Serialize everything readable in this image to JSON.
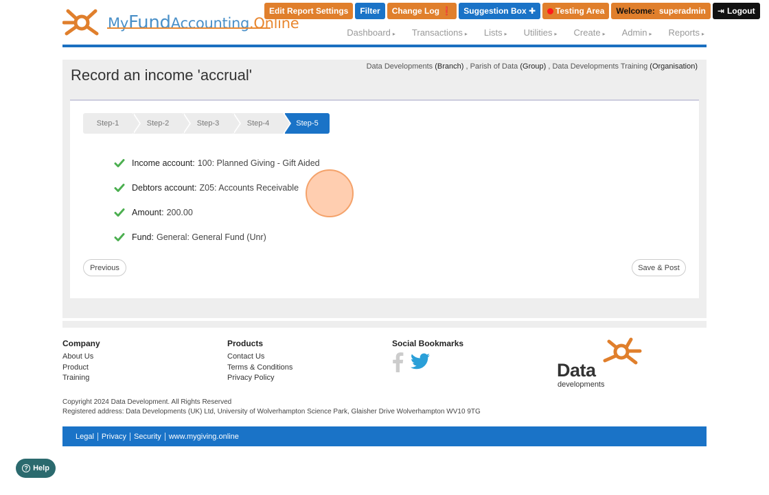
{
  "logo": {
    "part1": "My",
    "part2": "Fund",
    "part3": "Accounting",
    "part4": ".Online"
  },
  "top_buttons": {
    "edit_report_settings": "Edit Report Settings",
    "filter": "Filter",
    "change_log": "Change Log ❗",
    "suggestion_box": "Suggestion Box ✚",
    "testing_area": "Testing Area",
    "welcome_label": "Welcome:",
    "welcome_user": "superadmin",
    "logout": "Logout"
  },
  "nav": [
    "Dashboard",
    "Transactions",
    "Lists",
    "Utilities",
    "Create",
    "Admin",
    "Reports"
  ],
  "entity": {
    "branch_name": "Data Developments",
    "branch_tag": "(Branch)",
    "group_name": "Parish of Data",
    "group_tag": "(Group)",
    "org_name": "Data Developments Training",
    "org_tag": "(Organisation)"
  },
  "page_title": "Record an income 'accrual'",
  "steps": [
    "Step-1",
    "Step-2",
    "Step-3",
    "Step-4",
    "Step-5"
  ],
  "active_step": 5,
  "summary": [
    {
      "label": "Income account:",
      "value": "100: Planned Giving - Gift Aided"
    },
    {
      "label": "Debtors account:",
      "value": "Z05: Accounts Receivable"
    },
    {
      "label": "Amount:",
      "value": "200.00"
    },
    {
      "label": "Fund:",
      "value": "General: General Fund (Unr)"
    }
  ],
  "buttons": {
    "previous": "Previous",
    "save_post": "Save & Post"
  },
  "footer": {
    "company": {
      "title": "Company",
      "links": [
        "About Us",
        "Product",
        "Training"
      ]
    },
    "products": {
      "title": "Products",
      "links": [
        "Contact Us",
        "Terms & Conditions",
        "Privacy Policy"
      ]
    },
    "social": {
      "title": "Social Bookmarks"
    },
    "dd_logo": {
      "word": "Data",
      "sub": "developments"
    },
    "copyright": "Copyright 2024 Data Development. All Rights Reserved",
    "address": "Registered address: Data Developments (UK) Ltd, University of Wolverhampton Science Park, Glaisher Drive Wolverhampton WV10 9TG",
    "bottom_links": [
      "Legal",
      "Privacy",
      "Security",
      "www.mygiving.online"
    ]
  },
  "help": "Help",
  "colors": {
    "brand_blue": "#1a73c7",
    "brand_orange": "#e07f2c",
    "success_green": "#4caf50"
  },
  "icons": [
    "logo-star-icon",
    "check-icon",
    "facebook-icon",
    "twitter-icon",
    "logout-icon",
    "help-icon",
    "nav-caret-icon"
  ]
}
